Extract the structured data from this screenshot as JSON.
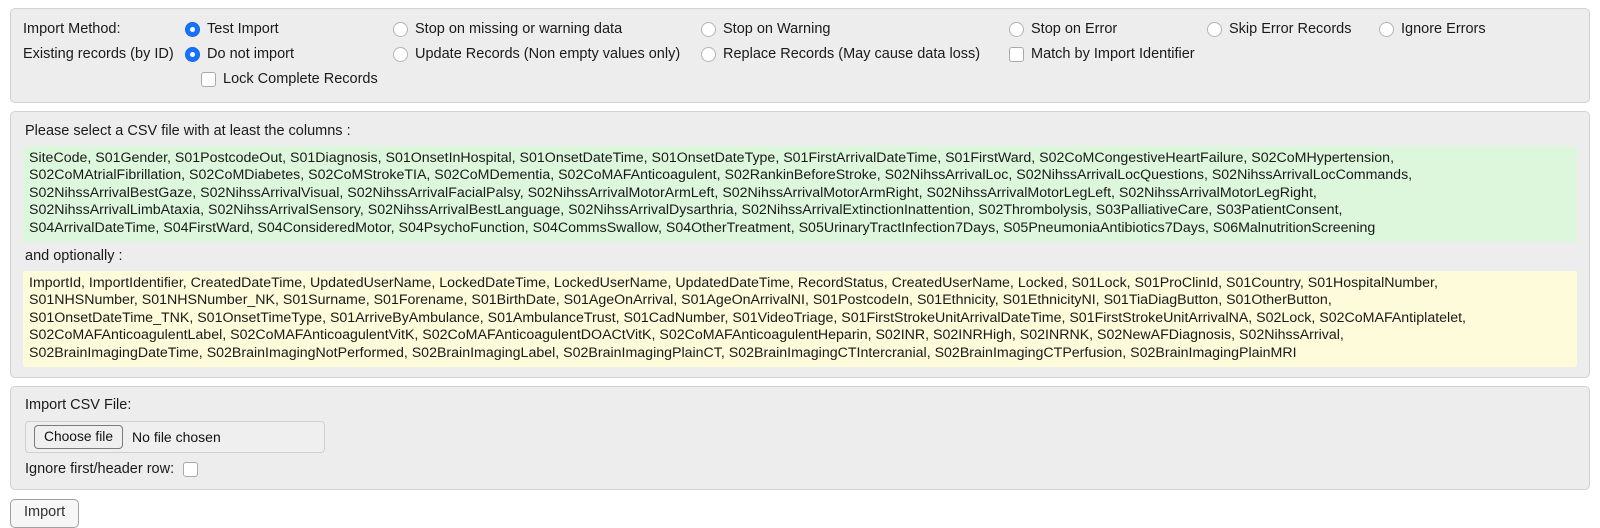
{
  "options": {
    "import_method_label": "Import Method:",
    "existing_records_label": "Existing records (by ID)",
    "import_method": [
      {
        "label": "Test Import",
        "checked": true
      },
      {
        "label": "Stop on missing or warning data",
        "checked": false
      },
      {
        "label": "Stop on Warning",
        "checked": false
      },
      {
        "label": "Stop on Error",
        "checked": false
      },
      {
        "label": "Skip Error Records",
        "checked": false
      },
      {
        "label": "Ignore Errors",
        "checked": false
      }
    ],
    "existing_records": [
      {
        "label": "Do not import",
        "checked": true
      },
      {
        "label": "Update Records (Non empty values only)",
        "checked": false
      },
      {
        "label": "Replace Records (May cause data loss)",
        "checked": false
      }
    ],
    "match_by_import_identifier": {
      "label": "Match by Import Identifier",
      "checked": false
    },
    "lock_complete_records": {
      "label": "Lock Complete Records",
      "checked": false
    }
  },
  "columns": {
    "required_heading": "Please select a CSV file with at least the columns :",
    "optional_heading": "and optionally :",
    "required_lines": [
      "SiteCode, S01Gender, S01PostcodeOut, S01Diagnosis, S01OnsetInHospital, S01OnsetDateTime, S01OnsetDateType, S01FirstArrivalDateTime, S01FirstWard, S02CoMCongestiveHeartFailure, S02CoMHypertension,",
      "S02CoMAtrialFibrillation, S02CoMDiabetes, S02CoMStrokeTIA, S02CoMDementia, S02CoMAFAnticoagulent, S02RankinBeforeStroke, S02NihssArrivalLoc, S02NihssArrivalLocQuestions, S02NihssArrivalLocCommands,",
      "S02NihssArrivalBestGaze, S02NihssArrivalVisual, S02NihssArrivalFacialPalsy, S02NihssArrivalMotorArmLeft, S02NihssArrivalMotorArmRight, S02NihssArrivalMotorLegLeft, S02NihssArrivalMotorLegRight,",
      "S02NihssArrivalLimbAtaxia, S02NihssArrivalSensory, S02NihssArrivalBestLanguage, S02NihssArrivalDysarthria, S02NihssArrivalExtinctionInattention, S02Thrombolysis, S03PalliativeCare, S03PatientConsent,",
      "S04ArrivalDateTime, S04FirstWard, S04ConsideredMotor, S04PsychoFunction, S04CommsSwallow, S04OtherTreatment, S05UrinaryTractInfection7Days, S05PneumoniaAntibiotics7Days, S06MalnutritionScreening"
    ],
    "optional_lines": [
      "ImportId, ImportIdentifier, CreatedDateTime, UpdatedUserName, LockedDateTime, LockedUserName, UpdatedDateTime, RecordStatus, CreatedUserName, Locked, S01Lock, S01ProClinId, S01Country, S01HospitalNumber,",
      "S01NHSNumber, S01NHSNumber_NK, S01Surname, S01Forename, S01BirthDate, S01AgeOnArrival, S01AgeOnArrivalNI, S01PostcodeIn, S01Ethnicity, S01EthnicityNI, S01TiaDiagButton, S01OtherButton,",
      "S01OnsetDateTime_TNK, S01OnsetTimeType, S01ArriveByAmbulance, S01AmbulanceTrust, S01CadNumber, S01VideoTriage, S01FirstStrokeUnitArrivalDateTime, S01FirstStrokeUnitArrivalNA, S02Lock, S02CoMAFAntiplatelet,",
      "S02CoMAFAnticoagulentLabel, S02CoMAFAnticoagulentVitK, S02CoMAFAnticoagulentDOACtVitK, S02CoMAFAnticoagulentHeparin, S02INR, S02INRHigh, S02INRNK, S02NewAFDiagnosis, S02NihssArrival,",
      "S02BrainImagingDateTime, S02BrainImagingNotPerformed, S02BrainImagingLabel, S02BrainImagingPlainCT, S02BrainImagingCTIntercranial, S02BrainImagingCTPerfusion, S02BrainImagingPlainMRI"
    ]
  },
  "file_section": {
    "label": "Import CSV File:",
    "choose_button": "Choose file",
    "file_status": "No file chosen",
    "ignore_header_row_label": "Ignore first/header row:",
    "ignore_header_row_checked": false
  },
  "footer": {
    "import_button": "Import"
  }
}
